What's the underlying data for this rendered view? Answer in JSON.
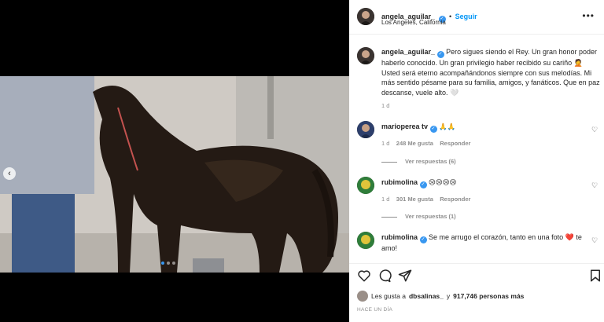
{
  "post": {
    "author": "angela_aguilar_",
    "follow_label": "Seguir",
    "location": "Los Angeles, California",
    "more_icon": "ellipsis-icon"
  },
  "caption": {
    "author": "angela_aguilar_",
    "text": "Pero sigues siendo el Rey. Un gran honor poder haberlo conocido. Un gran privilegio haber recibido su cariño 🤦 Usted será eterno acompañándonos siempre con sus melodías. Mi más sentido pésame para su familia, amigos, y fanáticos. Que en paz descanse, vuele alto. 🤍",
    "age": "1 d"
  },
  "comments": [
    {
      "author": "marioperea tv",
      "author_display": "marioperea tv",
      "text": "🙏🙏",
      "age": "1 d",
      "likes": "248 Me gusta",
      "reply_label": "Responder",
      "replies": "Ver respuestas (6)"
    },
    {
      "author": "rubimolina",
      "text": "😢😢😢😢",
      "age": "1 d",
      "likes": "301 Me gusta",
      "reply_label": "Responder",
      "replies": "Ver respuestas (1)"
    },
    {
      "author": "rubimolina",
      "text": "Se me arrugo el corazón, tanto en una foto ❤️ te amo!"
    }
  ],
  "likes_line": {
    "prefix": "Les gusta a",
    "user": "dbsalinas_",
    "middle": "y",
    "count": "917,746 personas más"
  },
  "timestamp": "HACE UN DÍA",
  "colors": {
    "accent": "#0095f6",
    "verified": "#3897f0"
  }
}
